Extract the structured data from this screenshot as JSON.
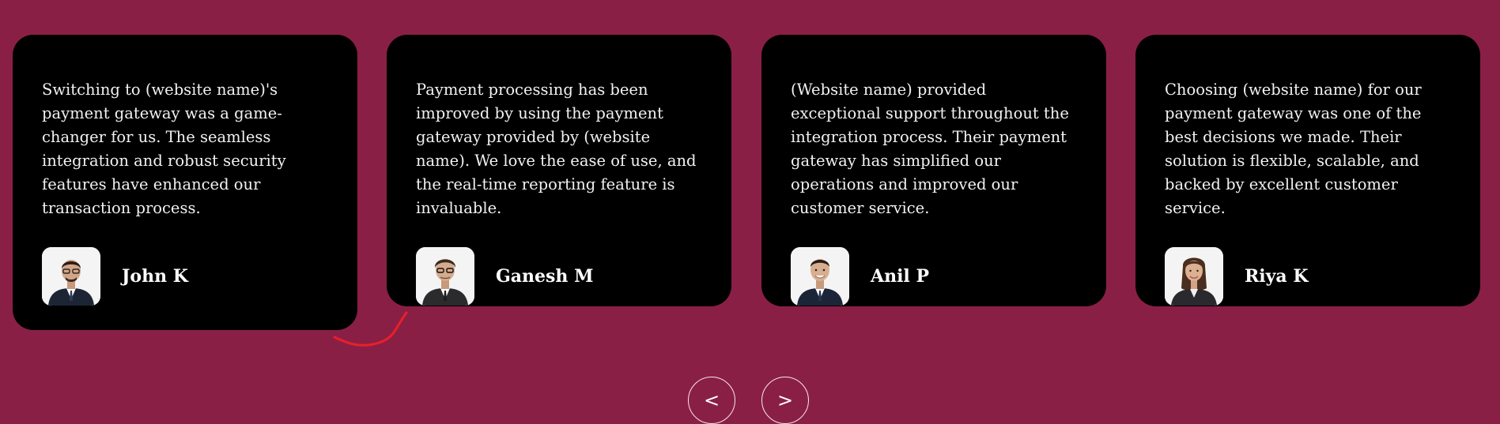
{
  "colors": {
    "background": "#8a1f45",
    "card": "#000000",
    "text": "#ffffff",
    "annotation": "#e8202a"
  },
  "testimonials": [
    {
      "quote": "Switching to (website name)'s payment gateway was a game-changer for us. The seamless integration and robust security features have enhanced our transaction process.",
      "name": "John K",
      "avatar_icon": "man-with-glasses-photo"
    },
    {
      "quote": "Payment processing has been improved by using the payment gateway provided by (website name). We love the ease of use, and the real-time reporting feature is invaluable.",
      "name": "Ganesh M",
      "avatar_icon": "man-with-glasses-photo"
    },
    {
      "quote": "(Website name) provided exceptional support throughout the integration process. Their payment gateway has simplified our operations and improved our customer service.",
      "name": "Anil P",
      "avatar_icon": "man-in-suit-photo"
    },
    {
      "quote": "Choosing (website name) for our payment gateway was one of the best decisions we made. Their solution is flexible, scalable, and backed by excellent customer service.",
      "name": "Riya K",
      "avatar_icon": "woman-in-blazer-photo"
    }
  ],
  "navigation": {
    "prev_label": "<",
    "next_label": ">"
  }
}
